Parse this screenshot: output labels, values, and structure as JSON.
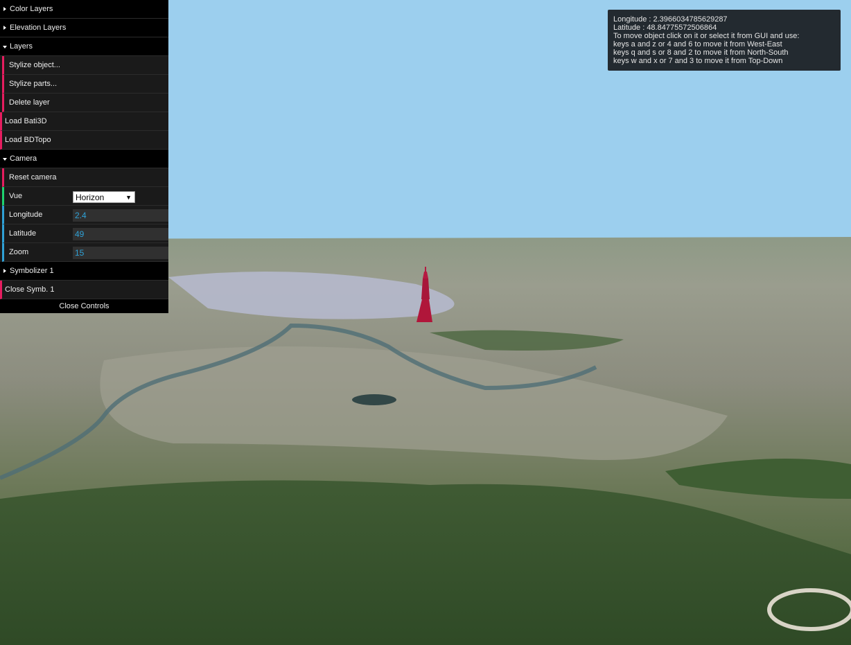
{
  "info_panel": {
    "longitude_line": "Longitude : 2.3966034785629287",
    "latitude_line": "Latitude : 48.84775572506864",
    "instructions": [
      "To move object click on it or select it from GUI and use:",
      "keys a and z or 4 and 6 to move it from West-East",
      "keys q and s or 8 and 2 to move it from North-South",
      "keys w and x or 7 and 3 to move it from Top-Down"
    ]
  },
  "gui": {
    "color_layers": "Color Layers",
    "elevation_layers": "Elevation Layers",
    "layers": {
      "title": "Layers",
      "stylize_object": "Stylize object...",
      "stylize_parts": "Stylize parts...",
      "delete_layer": "Delete layer"
    },
    "load_bati3d": "Load Bati3D",
    "load_bdtopo": "Load BDTopo",
    "camera": {
      "title": "Camera",
      "reset_camera": "Reset camera",
      "vue_label": "Vue",
      "vue_value": "Horizon",
      "longitude_label": "Longitude",
      "longitude_value": "2.4",
      "latitude_label": "Latitude",
      "latitude_value": "49",
      "zoom_label": "Zoom",
      "zoom_value": "15"
    },
    "symbolizer": "Symbolizer 1",
    "close_symb": "Close Symb. 1",
    "close_controls": "Close Controls"
  },
  "colors": {
    "sky": "#9ccfee",
    "function_accent": "#e61d5f",
    "number_accent": "#2fa1d6",
    "option_accent": "#1ed36f",
    "building": "#b0163a"
  },
  "icons": {
    "folder_closed": "triangle-right-icon",
    "folder_open": "triangle-down-icon",
    "select_arrow": "chevron-down-icon"
  }
}
